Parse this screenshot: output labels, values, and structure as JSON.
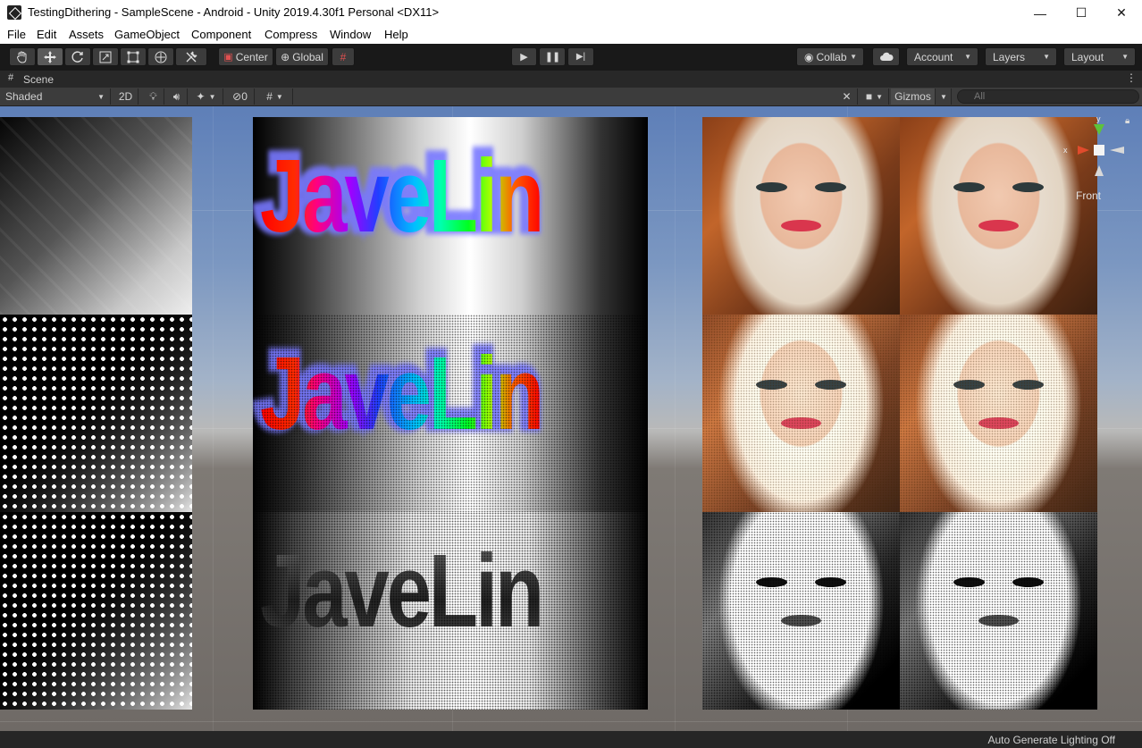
{
  "window": {
    "title": "TestingDithering - SampleScene - Android - Unity 2019.4.30f1 Personal <DX11>",
    "minimize": "—",
    "maximize": "☐",
    "close": "✕"
  },
  "menu": [
    "File",
    "Edit",
    "Assets",
    "GameObject",
    "Component",
    "Compress",
    "Window",
    "Help"
  ],
  "toolbar": {
    "tools": [
      "hand-tool",
      "move-tool",
      "rotate-tool",
      "scale-tool",
      "rect-tool",
      "transform-tool",
      "custom-tool"
    ],
    "center_label": "Center",
    "global_label": "Global",
    "collab_label": "Collab",
    "account_label": "Account",
    "layers_label": "Layers",
    "layout_label": "Layout"
  },
  "scene_tab": {
    "label": "Scene"
  },
  "scene_bar": {
    "shading_mode": "Shaded",
    "mode_2d": "2D",
    "hidden_count": "0",
    "gizmos_label": "Gizmos",
    "search_placeholder": "All"
  },
  "viewport": {
    "javelin_text": "JaveLin",
    "gizmo": {
      "x_axis": "x",
      "y_axis": "y",
      "view_label": "Front"
    }
  },
  "status": {
    "lighting": "Auto Generate Lighting Off"
  },
  "colors": {
    "toolbar_bg": "#191919",
    "panel_bg": "#3c3c3c",
    "sky_top": "#5e7fb8",
    "ground": "#6f6a66"
  }
}
